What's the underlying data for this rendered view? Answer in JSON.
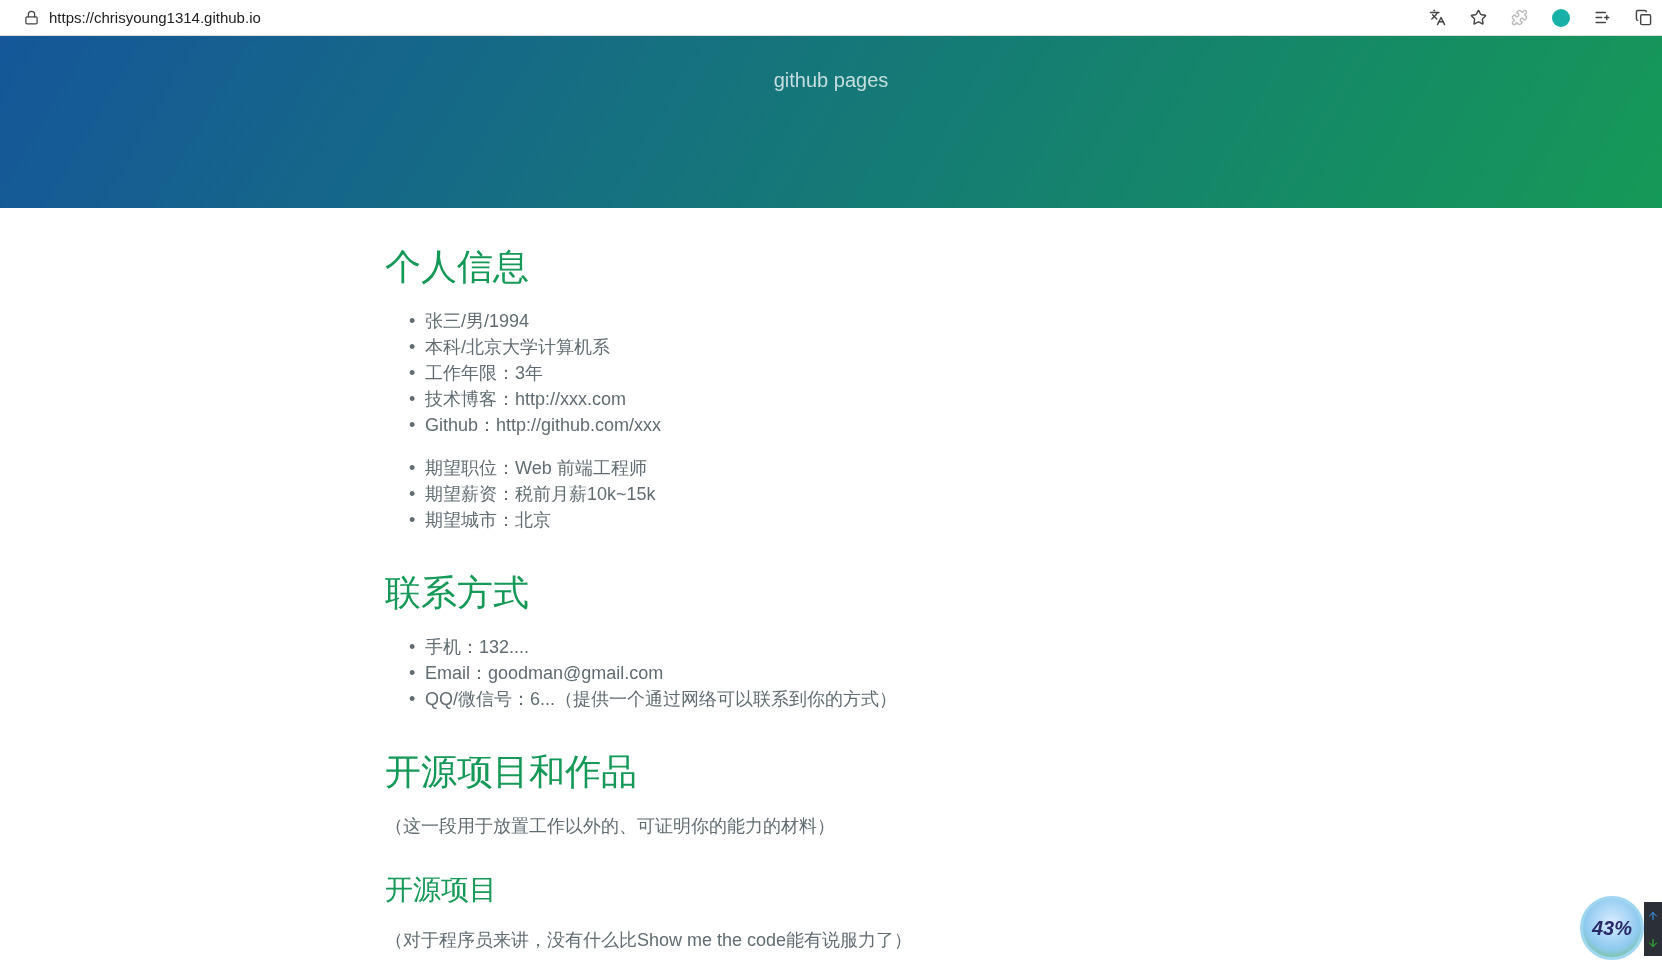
{
  "browser": {
    "url": "https://chrisyoung1314.github.io"
  },
  "header": {
    "subtitle": "github pages"
  },
  "content": [
    {
      "kind": "h2",
      "text": "个人信息"
    },
    {
      "kind": "list",
      "bullet": "•",
      "items": [
        "张三/男/1994",
        "本科/北京大学计算机系",
        "工作年限：3年",
        "技术博客：http://xxx.com",
        "Github：http://github.com/xxx"
      ]
    },
    {
      "kind": "list",
      "bullet": "•",
      "items": [
        "期望职位：Web 前端工程师",
        "期望薪资：税前月薪10k~15k",
        "期望城市：北京"
      ]
    },
    {
      "kind": "h2",
      "text": "联系方式"
    },
    {
      "kind": "list",
      "bullet": "•",
      "items": [
        "手机：132....",
        "Email：goodman@gmail.com",
        "QQ/微信号：6...（提供一个通过网络可以联系到你的方式）"
      ]
    },
    {
      "kind": "h2",
      "text": "开源项目和作品"
    },
    {
      "kind": "p",
      "text": "（这一段用于放置工作以外的、可证明你的能力的材料）"
    },
    {
      "kind": "h3",
      "text": "开源项目"
    },
    {
      "kind": "p",
      "text": "（对于程序员来讲，没有什么比Show me the code能有说服力了）"
    }
  ],
  "widget": {
    "percent": "43%"
  }
}
